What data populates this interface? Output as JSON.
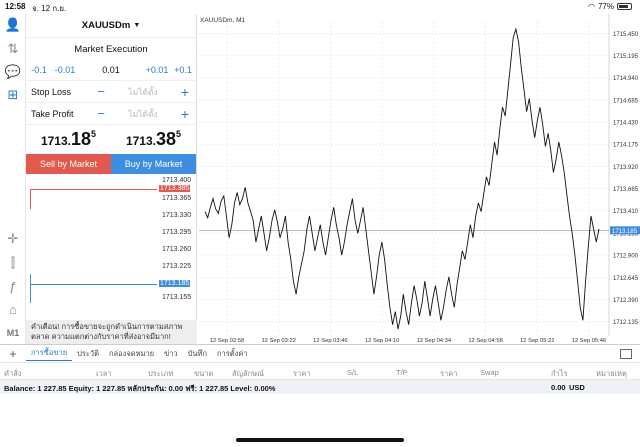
{
  "status_bar": {
    "time": "12:58",
    "date": "จ. 12 ก.ย.",
    "battery": "77%",
    "battery_level": 0.77
  },
  "toolbar": {
    "items": [
      {
        "name": "account-icon",
        "glyph": "👤"
      },
      {
        "name": "trade-icon",
        "glyph": "⇅"
      },
      {
        "name": "chat-icon",
        "glyph": "💬"
      },
      {
        "name": "new-order-icon",
        "glyph": "⊞"
      },
      {
        "name": "crosshair-icon",
        "glyph": "✛"
      },
      {
        "name": "chart-type-icon",
        "glyph": "⫿"
      },
      {
        "name": "indicators-icon",
        "glyph": "ƒ"
      },
      {
        "name": "objects-icon",
        "glyph": "⌂"
      }
    ],
    "timeframe": "M1"
  },
  "order": {
    "symbol": "XAUUSDm",
    "execution": "Market Execution",
    "steps_minus": [
      "-0.1",
      "-0.01"
    ],
    "volume": "0.01",
    "steps_plus": [
      "+0.01",
      "+0.1"
    ],
    "stop_loss": {
      "label": "Stop Loss",
      "value": "ไม่ได้ตั้ง"
    },
    "take_profit": {
      "label": "Take Profit",
      "value": "ไม่ได้ตั้ง"
    },
    "bid": {
      "main": "1713.",
      "big": "18",
      "sup": "5"
    },
    "ask": {
      "main": "1713.",
      "big": "38",
      "sup": "5"
    },
    "sell_label": "Sell by Market",
    "buy_label": "Buy by Market",
    "depth_ticks": [
      "1713.400",
      "1713.385",
      "1713.365",
      "1713.330",
      "1713.295",
      "1713.260",
      "1713.225",
      "1713.185",
      "1713.155"
    ],
    "warning": "คำเตือน! การซื้อขายจะถูกดำเนินการตามสภาพตลาด ความแตกต่างกับราคาที่ส่งอาจมีมาก!"
  },
  "chart": {
    "title": "XAUUSDm, M1",
    "current_price": "1713.185",
    "colors": {
      "line": "#111111",
      "grid": "#e3e3e3",
      "price_tag": "#3d8ee0",
      "ask_line": "#e25a4e"
    }
  },
  "chart_data": {
    "type": "line",
    "title": "XAUUSDm, M1",
    "y_ticks": [
      "1715.450",
      "1715.195",
      "1714.940",
      "1714.685",
      "1714.430",
      "1714.175",
      "1713.920",
      "1713.665",
      "1713.410",
      "1713.155",
      "1712.900",
      "1712.645",
      "1712.390",
      "1712.135"
    ],
    "x_ticks": [
      "12 Sep 02:58",
      "12 Sep 03:22",
      "12 Sep 03:46",
      "12 Sep 04:10",
      "12 Sep 04:34",
      "12 Sep 04:58",
      "12 Sep 05:22",
      "12 Sep 05:46"
    ],
    "ylim": [
      1711.97,
      1715.58
    ],
    "y": [
      1713.4,
      1713.33,
      1713.45,
      1713.55,
      1713.43,
      1713.38,
      1713.52,
      1713.58,
      1713.35,
      1713.1,
      1713.25,
      1713.5,
      1713.62,
      1713.48,
      1713.55,
      1713.68,
      1713.5,
      1713.4,
      1713.3,
      1713.05,
      1713.2,
      1713.35,
      1713.15,
      1712.95,
      1713.1,
      1713.3,
      1713.42,
      1713.28,
      1713.1,
      1713.2,
      1713.35,
      1713.05,
      1712.85,
      1712.6,
      1712.45,
      1712.65,
      1712.8,
      1712.95,
      1713.2,
      1713.35,
      1713.15,
      1712.95,
      1713.1,
      1713.25,
      1713.05,
      1712.9,
      1713.1,
      1713.3,
      1713.45,
      1713.25,
      1713.1,
      1712.9,
      1713.05,
      1713.25,
      1713.4,
      1713.55,
      1713.3,
      1713.15,
      1713.3,
      1713.45,
      1713.2,
      1712.95,
      1712.7,
      1712.45,
      1712.65,
      1712.9,
      1713.05,
      1712.85,
      1712.55,
      1712.3,
      1712.1,
      1712.25,
      1712.05,
      1712.2,
      1712.45,
      1712.25,
      1712.1,
      1712.35,
      1712.55,
      1712.4,
      1712.2,
      1712.35,
      1712.6,
      1712.4,
      1712.2,
      1712.4,
      1712.55,
      1712.35,
      1712.15,
      1712.3,
      1712.5,
      1712.65,
      1712.45,
      1712.3,
      1712.55,
      1712.75,
      1712.95,
      1712.85,
      1713.05,
      1713.25,
      1713.1,
      1713.35,
      1713.5,
      1713.4,
      1713.6,
      1713.8,
      1713.7,
      1713.95,
      1714.2,
      1714.05,
      1714.35,
      1714.6,
      1714.5,
      1714.8,
      1715.1,
      1715.4,
      1715.5,
      1715.35,
      1715.05,
      1714.8,
      1714.55,
      1714.7,
      1714.45,
      1714.25,
      1714.45,
      1714.6,
      1714.4,
      1714.15,
      1714.3,
      1714.1,
      1713.85,
      1714.0,
      1714.2,
      1714.05,
      1713.85,
      1713.6,
      1713.35,
      1713.15,
      1712.9,
      1712.6,
      1712.3,
      1712.15,
      1712.6,
      1713.0,
      1713.35,
      1713.2,
      1713.05,
      1713.2
    ]
  },
  "bottom": {
    "tabs": [
      "การซื้อขาย",
      "ประวัติ",
      "กล่องจดหมาย",
      "ข่าว",
      "บันทึก",
      "การตั้งค่า"
    ],
    "columns": [
      "คำสั่ง",
      "เวลา",
      "ประเภท",
      "ขนาด",
      "สัญลักษณ์",
      "ราคา",
      "S/L",
      "T/P",
      "ราคา",
      "Swap",
      "กำไร",
      "หมายเหตุ"
    ],
    "balance": "Balance: 1 227.85 Equity: 1 227.85 หลักประกัน: 0.00 ฟรี: 1 227.85 Level: 0.00%",
    "profit": "0.00",
    "currency": "USD"
  }
}
